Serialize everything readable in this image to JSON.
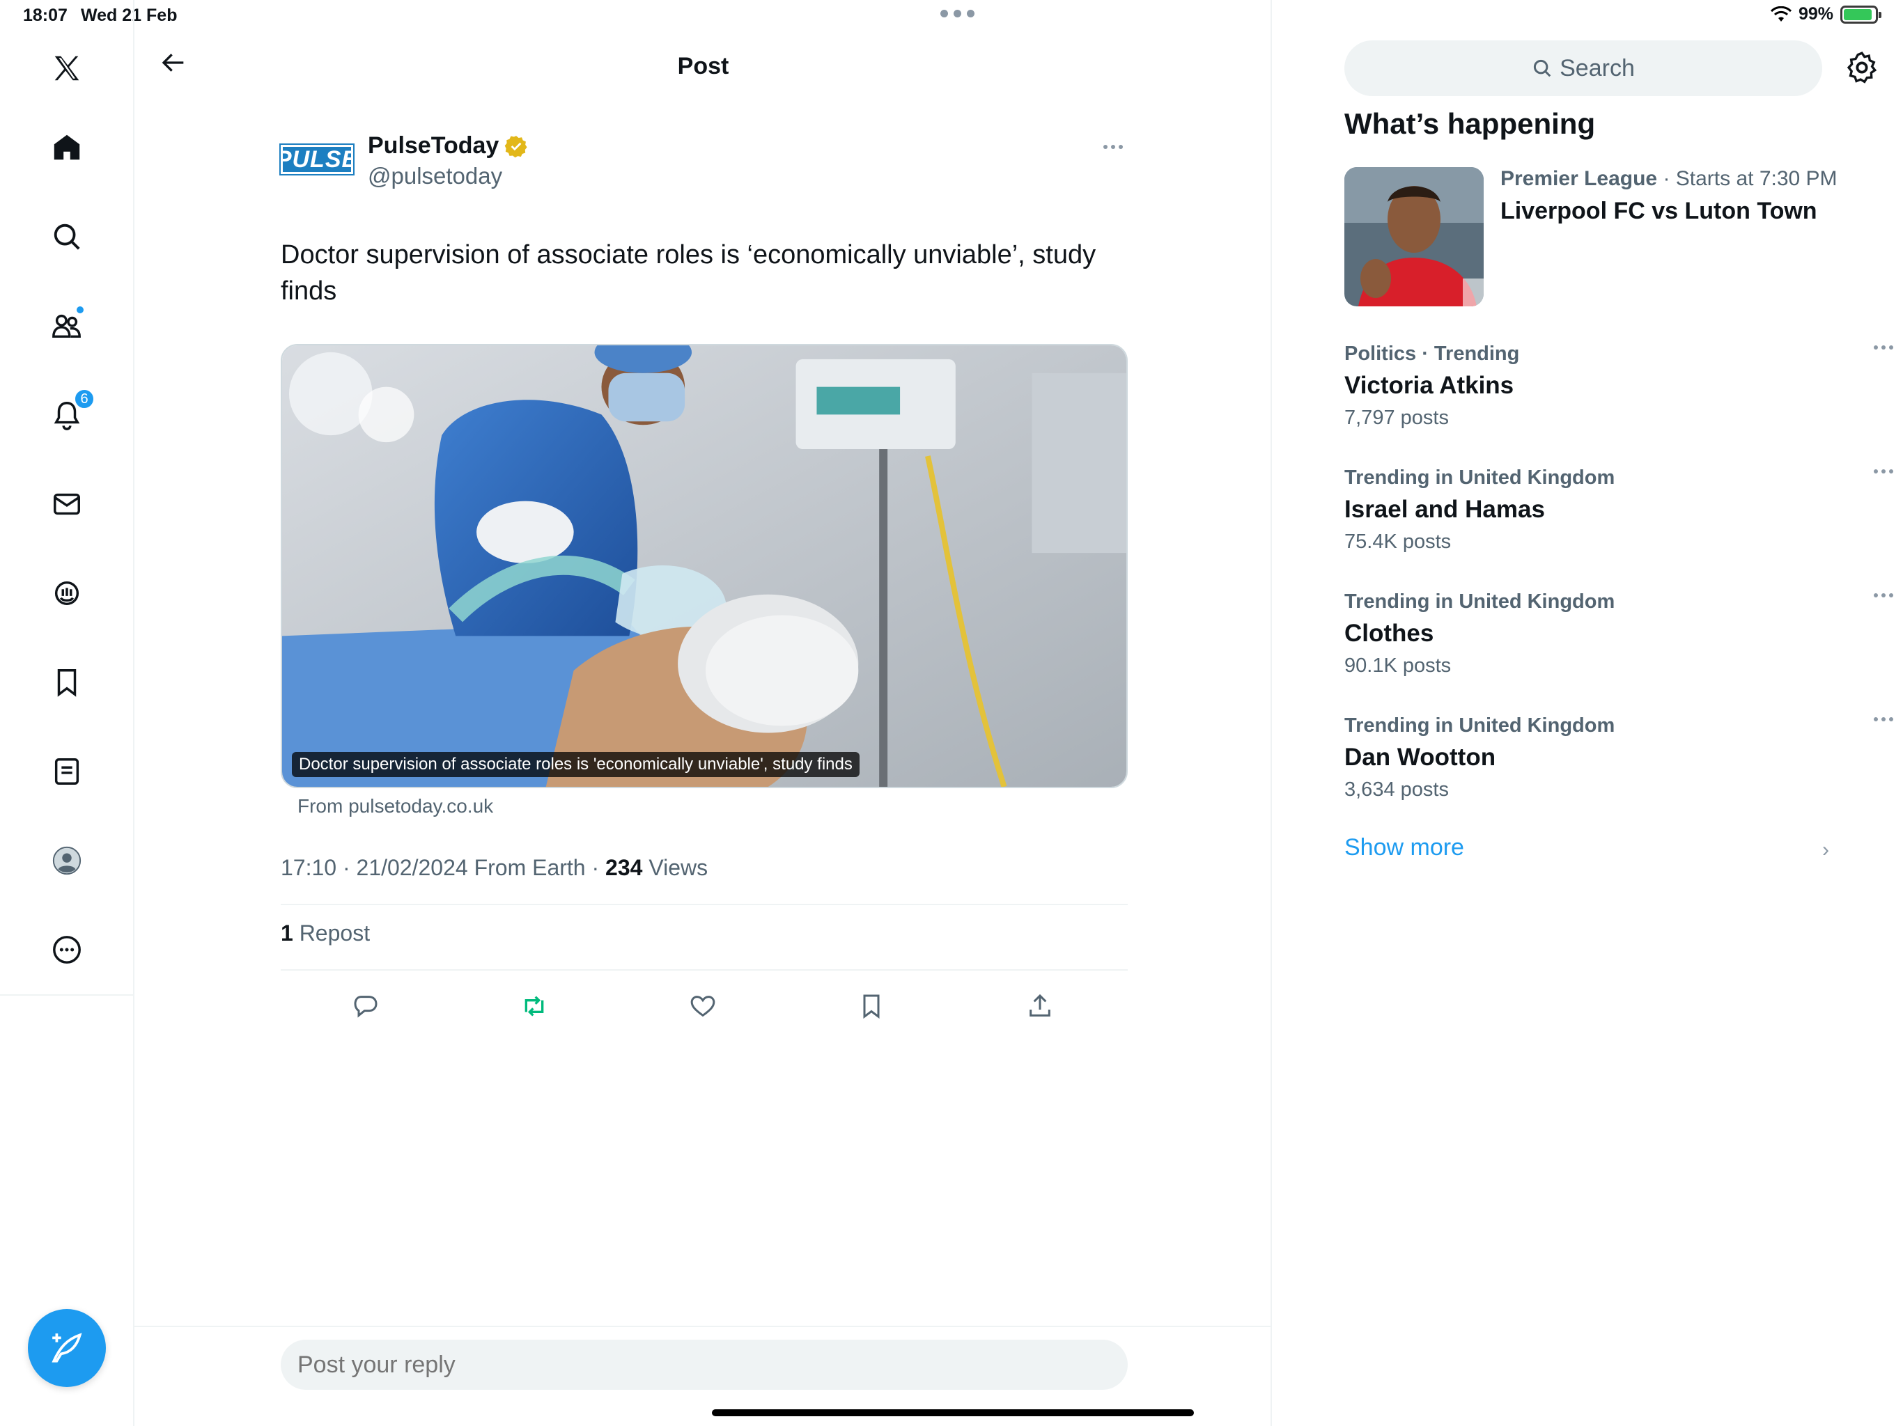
{
  "status_bar": {
    "time": "18:07",
    "date": "Wed 21 Feb",
    "battery": "99%"
  },
  "nav": {
    "notifications_count": "6"
  },
  "header": {
    "title": "Post"
  },
  "post": {
    "author_name": "PulseToday",
    "author_handle": "@pulsetoday",
    "avatar_text": "PULSE",
    "text": "Doctor supervision of associate roles is ‘economically unviable’, study finds",
    "media_caption": "Doctor supervision of associate roles is 'economically unviable', study finds",
    "media_source": "From pulsetoday.co.uk",
    "timestamp": "17:10 · 21/02/2024 From Earth · ",
    "views_count": "234",
    "views_label": " Views",
    "repost_count": "1",
    "repost_label": " Repost"
  },
  "reply": {
    "placeholder": "Post your reply"
  },
  "sidebar": {
    "search_placeholder": "Search",
    "section_title": "What’s happening",
    "event": {
      "category": "Premier League",
      "time": " · Starts at 7:30 PM",
      "title": "Liverpool FC vs Luton Town"
    },
    "trends": [
      {
        "category": "Politics · Trending",
        "name": "Victoria Atkins",
        "count": "7,797 posts"
      },
      {
        "category": "Trending in United Kingdom",
        "name": "Israel and Hamas",
        "count": "75.4K posts"
      },
      {
        "category": "Trending in United Kingdom",
        "name": "Clothes",
        "count": "90.1K posts"
      },
      {
        "category": "Trending in United Kingdom",
        "name": "Dan Wootton",
        "count": "3,634 posts"
      }
    ],
    "show_more": "Show more"
  },
  "colors": {
    "accent": "#1d9bf0",
    "repost_active": "#00ba7c",
    "verified": "#e2b719"
  },
  "icons": [
    "x-logo-icon",
    "home-icon",
    "search-icon",
    "communities-icon",
    "bell-icon",
    "mail-icon",
    "grok-icon",
    "bookmark-icon",
    "lists-icon",
    "profile-icon",
    "more-circle-icon",
    "compose-icon",
    "back-arrow-icon",
    "verified-icon",
    "reply-icon",
    "repost-icon",
    "like-icon",
    "share-icon",
    "gear-icon",
    "chevron-right-icon"
  ]
}
